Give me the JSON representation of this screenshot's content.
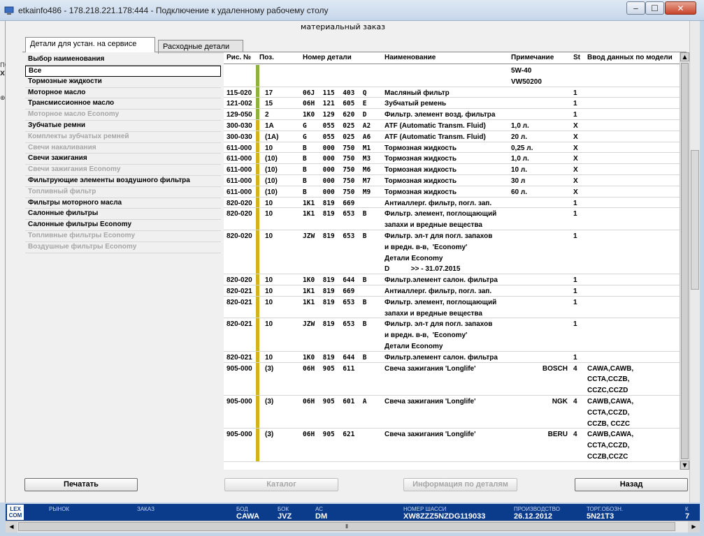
{
  "window": {
    "title": "etkainfo486 - 178.218.221.178:444 - Подключение к удаленному рабочему столу",
    "min": "‒",
    "max": "☐",
    "close": "✕"
  },
  "left_strip": {
    "fragment": "ПС",
    "mark": "X",
    "plus": "⊕"
  },
  "header": {
    "title": "материальный заказ"
  },
  "tabs": [
    "Детали для устан. на сервисе",
    "Расходные детали"
  ],
  "sidebar": {
    "header": "Выбор наименования",
    "items": [
      {
        "label": "Все",
        "enabled": true
      },
      {
        "label": "Тормозные жидкости",
        "enabled": true
      },
      {
        "label": "Моторное масло",
        "enabled": true
      },
      {
        "label": "Трансмиссионное масло",
        "enabled": true
      },
      {
        "label": "Моторное масло Economy",
        "enabled": false
      },
      {
        "label": "Зубчатые ремни",
        "enabled": true
      },
      {
        "label": "Комплекты зубчатых ремней",
        "enabled": false
      },
      {
        "label": "Свечи накаливания",
        "enabled": false
      },
      {
        "label": "Свечи зажигания",
        "enabled": true
      },
      {
        "label": "Свечи зажигания Economy",
        "enabled": false
      },
      {
        "label": "Фильтрующие элементы воздушного фильтра",
        "enabled": true
      },
      {
        "label": "Топливный фильтр",
        "enabled": false
      },
      {
        "label": "Фильтры моторного масла",
        "enabled": true
      },
      {
        "label": "Салонные фильтры",
        "enabled": true
      },
      {
        "label": "Салонные фильтры Economy",
        "enabled": true
      },
      {
        "label": "Топливные фильтры Economy",
        "enabled": false
      },
      {
        "label": "Воздушные фильтры Economy",
        "enabled": false
      }
    ]
  },
  "table": {
    "columns": [
      "Рис. №",
      "Поз.",
      "Номер детали",
      "Наименование",
      "Примечание",
      "St",
      "Ввод данных по модели"
    ],
    "rows": [
      {
        "fig": "",
        "pos": "",
        "part": "",
        "name": [
          ""
        ],
        "note": [
          "5W-40",
          "VW50200"
        ],
        "st": "",
        "model": [],
        "bar": "green"
      },
      {
        "fig": "115-020",
        "pos": "17",
        "part": "06J  115  403  Q",
        "name": [
          "Масляный фильтр"
        ],
        "note": [
          ""
        ],
        "st": "1",
        "model": [],
        "bar": "green"
      },
      {
        "fig": "121-002",
        "pos": "15",
        "part": "06H  121  605  E",
        "name": [
          "Зубчатый ремень"
        ],
        "note": [
          ""
        ],
        "st": "1",
        "model": [],
        "bar": "green"
      },
      {
        "fig": "129-050",
        "pos": "2",
        "part": "1K0  129  620  D",
        "name": [
          "Фильтр. элемент возд. фильтра"
        ],
        "note": [
          ""
        ],
        "st": "1",
        "model": [],
        "bar": "green"
      },
      {
        "fig": "300-030",
        "pos": "1A",
        "part": "G    055  025  A2",
        "name": [
          "ATF (Automatic Transm. Fluid)"
        ],
        "note": [
          "1,0 л."
        ],
        "st": "X",
        "model": [],
        "bar": "yellow"
      },
      {
        "fig": "300-030",
        "pos": "(1A)",
        "part": "G    055  025  A6",
        "name": [
          "ATF (Automatic Transm. Fluid)"
        ],
        "note": [
          "20 л."
        ],
        "st": "X",
        "model": [],
        "bar": "yellow"
      },
      {
        "fig": "611-000",
        "pos": "10",
        "part": "B    000  750  M1",
        "name": [
          "Тормозная жидкость"
        ],
        "note": [
          "0,25 л."
        ],
        "st": "X",
        "model": [],
        "bar": "yellow"
      },
      {
        "fig": "611-000",
        "pos": "(10)",
        "part": "B    000  750  M3",
        "name": [
          "Тормозная жидкость"
        ],
        "note": [
          "1,0 л."
        ],
        "st": "X",
        "model": [],
        "bar": "yellow"
      },
      {
        "fig": "611-000",
        "pos": "(10)",
        "part": "B    000  750  M6",
        "name": [
          "Тормозная жидкость"
        ],
        "note": [
          "10 л."
        ],
        "st": "X",
        "model": [],
        "bar": "yellow"
      },
      {
        "fig": "611-000",
        "pos": "(10)",
        "part": "B    000  750  M7",
        "name": [
          "Тормозная жидкость"
        ],
        "note": [
          "30 л"
        ],
        "st": "X",
        "model": [],
        "bar": "yellow"
      },
      {
        "fig": "611-000",
        "pos": "(10)",
        "part": "B    000  750  M9",
        "name": [
          "Тормозная жидкость"
        ],
        "note": [
          "60 л."
        ],
        "st": "X",
        "model": [],
        "bar": "yellow"
      },
      {
        "fig": "820-020",
        "pos": "10",
        "part": "1K1  819  669",
        "name": [
          "Антиаллерг. фильтр, погл. зап."
        ],
        "note": [
          ""
        ],
        "st": "1",
        "model": [],
        "bar": "yellow"
      },
      {
        "fig": "820-020",
        "pos": "10",
        "part": "1K1  819  653  B",
        "name": [
          "Фильтр. элемент, поглощающий",
          "запахи и вредные вещества"
        ],
        "note": [
          ""
        ],
        "st": "1",
        "model": [],
        "bar": "yellow"
      },
      {
        "fig": "820-020",
        "pos": "10",
        "part": "JZW  819  653  B",
        "name": [
          "Фильтр. эл-т для погл. запахов",
          "и вредн. в-в,  'Economy'",
          "Детали Economy",
          "D           >> - 31.07.2015"
        ],
        "note": [
          ""
        ],
        "st": "1",
        "model": [],
        "bar": "yellow"
      },
      {
        "fig": "820-020",
        "pos": "10",
        "part": "1K0  819  644  B",
        "name": [
          "Фильтр.элемент салон. фильтра"
        ],
        "note": [
          ""
        ],
        "st": "1",
        "model": [],
        "bar": "yellow"
      },
      {
        "fig": "820-021",
        "pos": "10",
        "part": "1K1  819  669",
        "name": [
          "Антиаллерг. фильтр, погл. зап."
        ],
        "note": [
          ""
        ],
        "st": "1",
        "model": [],
        "bar": "yellow"
      },
      {
        "fig": "820-021",
        "pos": "10",
        "part": "1K1  819  653  B",
        "name": [
          "Фильтр. элемент, поглощающий",
          "запахи и вредные вещества"
        ],
        "note": [
          ""
        ],
        "st": "1",
        "model": [],
        "bar": "yellow"
      },
      {
        "fig": "820-021",
        "pos": "10",
        "part": "JZW  819  653  B",
        "name": [
          "Фильтр. эл-т для погл. запахов",
          "и вредн. в-в,  'Economy'",
          "Детали Economy"
        ],
        "note": [
          ""
        ],
        "st": "1",
        "model": [],
        "bar": "yellow"
      },
      {
        "fig": "820-021",
        "pos": "10",
        "part": "1K0  819  644  B",
        "name": [
          "Фильтр.элемент салон. фильтра"
        ],
        "note": [
          ""
        ],
        "st": "1",
        "model": [],
        "bar": "yellow"
      },
      {
        "fig": "905-000",
        "pos": "(3)",
        "part": "06H  905  611",
        "name": [
          "Свеча зажигания 'Longlife'"
        ],
        "note": [
          "BOSCH"
        ],
        "st": "4",
        "model": [
          "CAWA,CAWB,",
          "CCTA,CCZB,",
          "CCZC,CCZD"
        ],
        "bar": "yellow"
      },
      {
        "fig": "905-000",
        "pos": "(3)",
        "part": "06H  905  601  A",
        "name": [
          "Свеча зажигания 'Longlife'"
        ],
        "note": [
          "NGK"
        ],
        "st": "4",
        "model": [
          "CAWB,CAWA,",
          "CCTA,CCZD,",
          "CCZB, CCZC"
        ],
        "bar": "yellow"
      },
      {
        "fig": "905-000",
        "pos": "(3)",
        "part": "06H  905  621",
        "name": [
          "Свеча зажигания 'Longlife'"
        ],
        "note": [
          "BERU"
        ],
        "st": "4",
        "model": [
          "CAWB,CAWA,",
          "CCTA,CCZD,",
          "CCZB,CCZC"
        ],
        "bar": "yellow"
      }
    ]
  },
  "buttons": {
    "print": "Печатать",
    "catalog": "Каталог",
    "info": "Информация по деталям",
    "back": "Назад"
  },
  "status": {
    "logo": "LEX COM",
    "labels": [
      "РЫНОК",
      "ЗАКАЗ",
      "БОД",
      "БОК",
      "АС",
      "НОМЕР ШАССИ",
      "ПРОИЗВОДСТВО",
      "ТОРГ.ОБОЗН.",
      "К"
    ],
    "values": [
      "",
      "",
      "CAWA",
      "JVZ",
      "DM",
      "XW8ZZZ5NZDG119033",
      "26.12.2012",
      "5N21T3",
      "7"
    ]
  },
  "colors": {
    "green": "#8db33a",
    "yellow": "#d4b21a",
    "statusbar": "#0b3c8c"
  }
}
